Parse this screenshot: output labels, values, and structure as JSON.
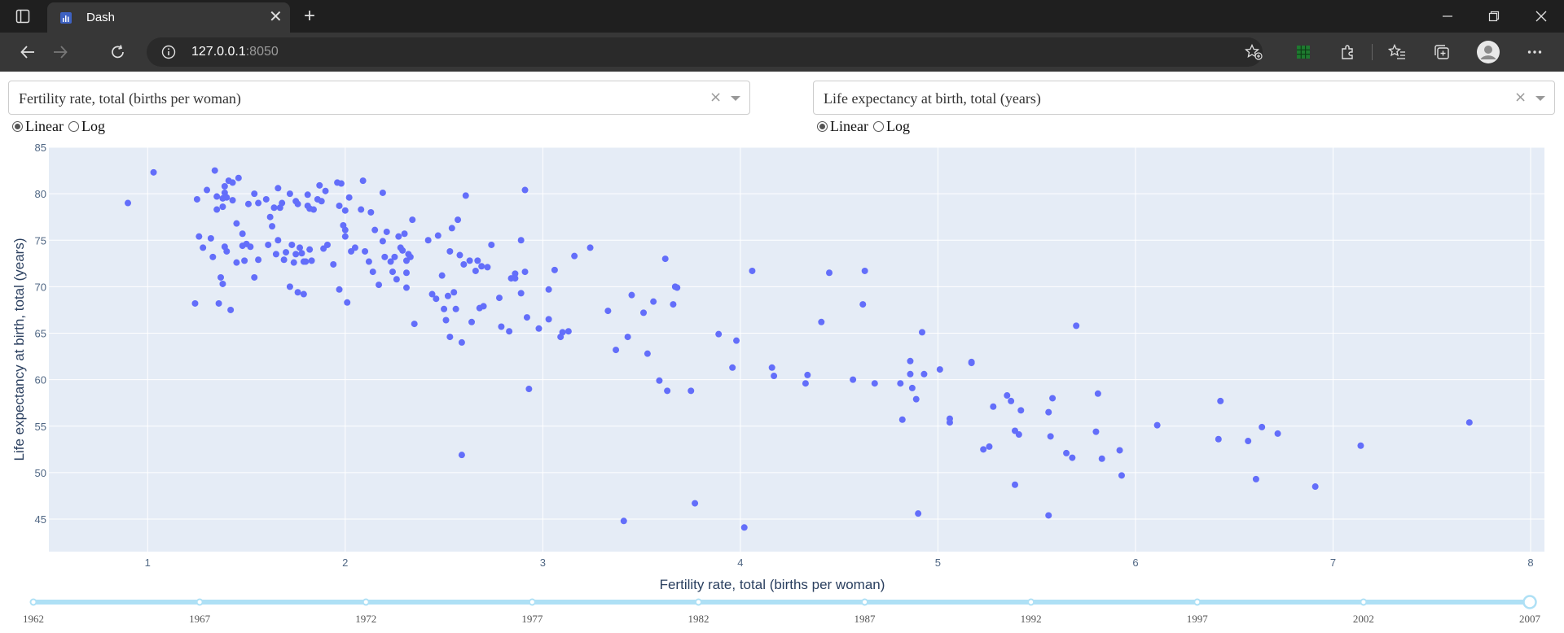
{
  "browser": {
    "tab_title": "Dash",
    "url_host": "127.0.0.1",
    "url_port": ":8050",
    "accent": "#373737"
  },
  "controls": {
    "xaxis_dropdown": {
      "value": "Fertility rate, total (births per woman)",
      "clear": "×"
    },
    "yaxis_dropdown": {
      "value": "Life expectancy at birth, total (years)",
      "clear": "×"
    },
    "xaxis_type": {
      "options": [
        "Linear",
        "Log"
      ],
      "selected": "Linear"
    },
    "yaxis_type": {
      "options": [
        "Linear",
        "Log"
      ],
      "selected": "Linear"
    }
  },
  "chart_data": {
    "type": "scatter",
    "xlabel": "Fertility rate, total (births per woman)",
    "ylabel": "Life expectancy at birth, total (years)",
    "xlim": [
      0.5,
      8.07
    ],
    "ylim": [
      41.5,
      85
    ],
    "xticks": [
      1,
      2,
      3,
      4,
      5,
      6,
      7,
      8
    ],
    "yticks": [
      45,
      50,
      55,
      60,
      65,
      70,
      75,
      80,
      85
    ],
    "grid": true,
    "marker_color": "#636efa",
    "plot_background": "#e5ecf6",
    "points": [
      [
        0.9,
        79.0
      ],
      [
        1.03,
        82.3
      ],
      [
        1.24,
        68.2
      ],
      [
        1.25,
        79.4
      ],
      [
        1.26,
        75.4
      ],
      [
        1.28,
        74.2
      ],
      [
        1.3,
        80.4
      ],
      [
        1.32,
        75.2
      ],
      [
        1.33,
        73.2
      ],
      [
        1.34,
        82.5
      ],
      [
        1.35,
        79.7
      ],
      [
        1.35,
        78.3
      ],
      [
        1.36,
        68.2
      ],
      [
        1.37,
        71.0
      ],
      [
        1.38,
        70.3
      ],
      [
        1.38,
        78.6
      ],
      [
        1.38,
        79.5
      ],
      [
        1.39,
        74.3
      ],
      [
        1.39,
        80.1
      ],
      [
        1.39,
        80.8
      ],
      [
        1.4,
        79.6
      ],
      [
        1.4,
        73.8
      ],
      [
        1.41,
        81.4
      ],
      [
        1.42,
        67.5
      ],
      [
        1.43,
        81.2
      ],
      [
        1.43,
        79.3
      ],
      [
        1.45,
        76.8
      ],
      [
        1.45,
        72.6
      ],
      [
        1.46,
        81.7
      ],
      [
        1.48,
        75.7
      ],
      [
        1.48,
        74.4
      ],
      [
        1.49,
        72.8
      ],
      [
        1.5,
        74.6
      ],
      [
        1.51,
        78.9
      ],
      [
        1.52,
        74.3
      ],
      [
        1.54,
        71.0
      ],
      [
        1.54,
        80.0
      ],
      [
        1.56,
        72.9
      ],
      [
        1.56,
        79.0
      ],
      [
        1.6,
        79.4
      ],
      [
        1.61,
        74.5
      ],
      [
        1.62,
        77.5
      ],
      [
        1.63,
        76.5
      ],
      [
        1.64,
        78.5
      ],
      [
        1.65,
        73.5
      ],
      [
        1.66,
        80.6
      ],
      [
        1.66,
        75.0
      ],
      [
        1.67,
        78.5
      ],
      [
        1.68,
        79.0
      ],
      [
        1.69,
        72.9
      ],
      [
        1.7,
        73.7
      ],
      [
        1.72,
        70.0
      ],
      [
        1.72,
        80.0
      ],
      [
        1.73,
        74.5
      ],
      [
        1.74,
        72.6
      ],
      [
        1.75,
        73.5
      ],
      [
        1.75,
        79.2
      ],
      [
        1.76,
        78.9
      ],
      [
        1.76,
        69.4
      ],
      [
        1.77,
        74.2
      ],
      [
        1.78,
        73.6
      ],
      [
        1.79,
        72.7
      ],
      [
        1.79,
        69.2
      ],
      [
        1.8,
        72.7
      ],
      [
        1.81,
        78.7
      ],
      [
        1.81,
        79.9
      ],
      [
        1.82,
        78.4
      ],
      [
        1.82,
        74.0
      ],
      [
        1.83,
        72.8
      ],
      [
        1.84,
        78.3
      ],
      [
        1.86,
        79.4
      ],
      [
        1.87,
        80.9
      ],
      [
        1.88,
        79.2
      ],
      [
        1.89,
        74.1
      ],
      [
        1.9,
        80.3
      ],
      [
        1.91,
        74.5
      ],
      [
        1.94,
        72.4
      ],
      [
        1.96,
        81.2
      ],
      [
        1.97,
        78.7
      ],
      [
        1.97,
        69.7
      ],
      [
        1.98,
        81.1
      ],
      [
        1.99,
        76.6
      ],
      [
        2.0,
        75.4
      ],
      [
        2.0,
        78.2
      ],
      [
        2.0,
        76.1
      ],
      [
        2.01,
        68.3
      ],
      [
        2.02,
        79.6
      ],
      [
        2.03,
        73.8
      ],
      [
        2.05,
        74.2
      ],
      [
        2.08,
        78.3
      ],
      [
        2.09,
        81.4
      ],
      [
        2.1,
        73.8
      ],
      [
        2.12,
        72.7
      ],
      [
        2.13,
        78.0
      ],
      [
        2.14,
        71.6
      ],
      [
        2.15,
        76.1
      ],
      [
        2.17,
        70.2
      ],
      [
        2.19,
        80.1
      ],
      [
        2.19,
        74.9
      ],
      [
        2.2,
        73.2
      ],
      [
        2.21,
        75.9
      ],
      [
        2.23,
        72.7
      ],
      [
        2.24,
        71.6
      ],
      [
        2.25,
        73.2
      ],
      [
        2.26,
        70.8
      ],
      [
        2.27,
        75.4
      ],
      [
        2.28,
        74.2
      ],
      [
        2.29,
        73.9
      ],
      [
        2.3,
        75.7
      ],
      [
        2.31,
        71.5
      ],
      [
        2.31,
        72.8
      ],
      [
        2.31,
        69.9
      ],
      [
        2.32,
        73.5
      ],
      [
        2.33,
        73.2
      ],
      [
        2.34,
        77.2
      ],
      [
        2.35,
        66.0
      ],
      [
        2.42,
        75.0
      ],
      [
        2.44,
        69.2
      ],
      [
        2.46,
        68.7
      ],
      [
        2.47,
        75.5
      ],
      [
        2.49,
        71.2
      ],
      [
        2.5,
        67.6
      ],
      [
        2.51,
        66.4
      ],
      [
        2.52,
        69.0
      ],
      [
        2.53,
        73.8
      ],
      [
        2.53,
        64.6
      ],
      [
        2.54,
        76.3
      ],
      [
        2.55,
        69.4
      ],
      [
        2.56,
        67.6
      ],
      [
        2.57,
        77.2
      ],
      [
        2.58,
        73.4
      ],
      [
        2.59,
        64.0
      ],
      [
        2.59,
        51.9
      ],
      [
        2.6,
        72.4
      ],
      [
        2.61,
        79.8
      ],
      [
        2.63,
        72.8
      ],
      [
        2.64,
        66.2
      ],
      [
        2.66,
        71.7
      ],
      [
        2.67,
        72.8
      ],
      [
        2.68,
        67.7
      ],
      [
        2.69,
        72.2
      ],
      [
        2.7,
        67.9
      ],
      [
        2.72,
        72.1
      ],
      [
        2.74,
        74.5
      ],
      [
        2.78,
        68.8
      ],
      [
        2.79,
        65.7
      ],
      [
        2.83,
        65.2
      ],
      [
        2.84,
        70.9
      ],
      [
        2.86,
        71.4
      ],
      [
        2.86,
        70.9
      ],
      [
        2.89,
        69.3
      ],
      [
        2.89,
        75.0
      ],
      [
        2.91,
        80.4
      ],
      [
        2.91,
        71.6
      ],
      [
        2.92,
        66.7
      ],
      [
        2.93,
        59.0
      ],
      [
        2.98,
        65.5
      ],
      [
        3.03,
        66.5
      ],
      [
        3.03,
        69.7
      ],
      [
        3.06,
        71.8
      ],
      [
        3.09,
        64.6
      ],
      [
        3.1,
        65.1
      ],
      [
        3.13,
        65.2
      ],
      [
        3.16,
        73.3
      ],
      [
        3.24,
        74.2
      ],
      [
        3.33,
        67.4
      ],
      [
        3.37,
        63.2
      ],
      [
        3.41,
        44.8
      ],
      [
        3.43,
        64.6
      ],
      [
        3.45,
        69.1
      ],
      [
        3.51,
        67.2
      ],
      [
        3.53,
        62.8
      ],
      [
        3.56,
        68.4
      ],
      [
        3.59,
        59.9
      ],
      [
        3.62,
        73.0
      ],
      [
        3.63,
        58.8
      ],
      [
        3.66,
        68.1
      ],
      [
        3.67,
        70.0
      ],
      [
        3.68,
        69.9
      ],
      [
        3.75,
        58.8
      ],
      [
        3.77,
        46.7
      ],
      [
        3.89,
        64.9
      ],
      [
        3.96,
        61.3
      ],
      [
        3.98,
        64.2
      ],
      [
        4.02,
        44.1
      ],
      [
        4.06,
        71.7
      ],
      [
        4.16,
        61.3
      ],
      [
        4.17,
        60.4
      ],
      [
        4.33,
        59.6
      ],
      [
        4.34,
        60.5
      ],
      [
        4.41,
        66.2
      ],
      [
        4.45,
        71.5
      ],
      [
        4.57,
        60.0
      ],
      [
        4.62,
        68.1
      ],
      [
        4.63,
        71.7
      ],
      [
        4.68,
        59.6
      ],
      [
        4.81,
        59.6
      ],
      [
        4.82,
        55.7
      ],
      [
        4.86,
        62.0
      ],
      [
        4.86,
        60.6
      ],
      [
        4.87,
        59.1
      ],
      [
        4.89,
        57.9
      ],
      [
        4.9,
        45.6
      ],
      [
        4.92,
        65.1
      ],
      [
        4.93,
        60.6
      ],
      [
        5.01,
        61.1
      ],
      [
        5.06,
        55.8
      ],
      [
        5.06,
        55.4
      ],
      [
        5.17,
        61.8
      ],
      [
        5.17,
        61.9
      ],
      [
        5.23,
        52.5
      ],
      [
        5.26,
        52.8
      ],
      [
        5.28,
        57.1
      ],
      [
        5.35,
        58.3
      ],
      [
        5.37,
        57.7
      ],
      [
        5.39,
        54.5
      ],
      [
        5.39,
        48.7
      ],
      [
        5.41,
        54.1
      ],
      [
        5.42,
        56.7
      ],
      [
        5.56,
        56.5
      ],
      [
        5.56,
        45.4
      ],
      [
        5.57,
        53.9
      ],
      [
        5.58,
        58.0
      ],
      [
        5.65,
        52.1
      ],
      [
        5.68,
        51.6
      ],
      [
        5.7,
        65.8
      ],
      [
        5.8,
        54.4
      ],
      [
        5.81,
        58.5
      ],
      [
        5.83,
        51.5
      ],
      [
        5.92,
        52.4
      ],
      [
        5.93,
        49.7
      ],
      [
        6.11,
        55.1
      ],
      [
        6.42,
        53.6
      ],
      [
        6.43,
        57.7
      ],
      [
        6.57,
        53.4
      ],
      [
        6.61,
        49.3
      ],
      [
        6.64,
        54.9
      ],
      [
        6.72,
        54.2
      ],
      [
        6.91,
        48.5
      ],
      [
        7.14,
        52.9
      ],
      [
        7.69,
        55.4
      ]
    ]
  },
  "slider": {
    "marks": [
      "1962",
      "1967",
      "1972",
      "1977",
      "1982",
      "1987",
      "1992",
      "1997",
      "2002",
      "2007"
    ],
    "min": 1962,
    "max": 2007,
    "value": 2007,
    "track_color": "#aee0f5"
  }
}
